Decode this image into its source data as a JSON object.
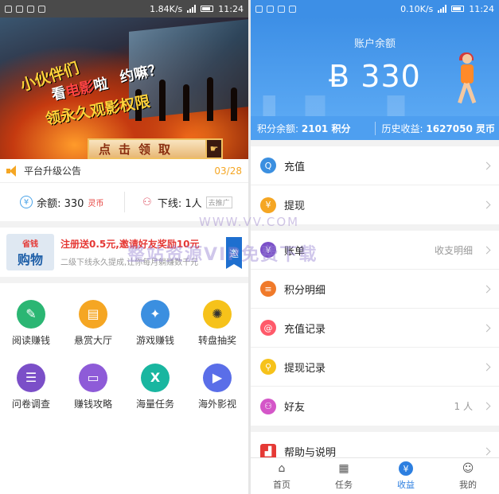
{
  "left": {
    "status": {
      "speed": "1.84K/s",
      "time": "11:24"
    },
    "banner": {
      "line1": "小伙伴们",
      "line2a": "看",
      "line2b": "电影",
      "line2c": "啦",
      "line3": "约嘛？",
      "line4": "领永久观影权限",
      "button": "点击领取"
    },
    "notice": {
      "text": "平台升级公告",
      "page": "03/28"
    },
    "balance": {
      "label": "余额: 330",
      "unit": "灵币"
    },
    "downline": {
      "label": "下线: 1人",
      "tag": "去推广"
    },
    "promo": {
      "logo_top": "省钱",
      "logo_bottom": "购物",
      "main": "注册送0.5元,邀请好友奖励10元",
      "sub": "二级下线永久提成,让你每月躺赚数千元",
      "flag": "邀"
    },
    "grid": [
      {
        "label": "阅读赚钱",
        "icon": "edit-icon",
        "color": "#2bb673",
        "glyph": "✎"
      },
      {
        "label": "悬赏大厅",
        "icon": "reward-icon",
        "color": "#f5a623",
        "glyph": "▤"
      },
      {
        "label": "游戏赚钱",
        "icon": "game-icon",
        "color": "#3b8fe0",
        "glyph": "✦"
      },
      {
        "label": "转盘抽奖",
        "icon": "wheel-icon",
        "color": "#f6c21a",
        "glyph": "✺"
      },
      {
        "label": "问卷调查",
        "icon": "survey-icon",
        "color": "#7b4fc8",
        "glyph": "☰"
      },
      {
        "label": "赚钱攻略",
        "icon": "guide-icon",
        "color": "#8e5bd8",
        "glyph": "▭"
      },
      {
        "label": "海量任务",
        "icon": "task-icon",
        "color": "#19b6a0",
        "glyph": "X"
      },
      {
        "label": "海外影视",
        "icon": "video-icon",
        "color": "#5a6ee8",
        "glyph": "▶"
      }
    ]
  },
  "right": {
    "status": {
      "speed": "0.10K/s",
      "time": "11:24"
    },
    "header": {
      "title": "账户余额",
      "amount": "Ƀ 330"
    },
    "stats": {
      "points_label": "积分余额:",
      "points_value": "2101 积分",
      "history_label": "历史收益:",
      "history_value": "1627050 灵币"
    },
    "group1": [
      {
        "label": "充值",
        "icon": "recharge-icon",
        "color": "#3b8fe0",
        "glyph": "Q"
      },
      {
        "label": "提现",
        "icon": "withdraw-icon",
        "color": "#f5a623",
        "glyph": "¥"
      }
    ],
    "group2": [
      {
        "label": "账单",
        "value": "收支明细",
        "icon": "bill-icon",
        "color": "#7b4fc8",
        "glyph": "¥"
      },
      {
        "label": "积分明细",
        "value": "",
        "icon": "points-icon",
        "color": "#f07a2a",
        "glyph": "≡"
      },
      {
        "label": "充值记录",
        "value": "",
        "icon": "recharge-record-icon",
        "color": "#ff5a6a",
        "glyph": "@"
      },
      {
        "label": "提现记录",
        "value": "",
        "icon": "withdraw-record-icon",
        "color": "#f6c21a",
        "glyph": "⚲"
      },
      {
        "label": "好友",
        "value": "1 人",
        "icon": "friends-icon",
        "color": "#d456c8",
        "glyph": "⚇"
      }
    ],
    "group3": [
      {
        "label": "帮助与说明",
        "icon": "help-icon",
        "color": "#e53935",
        "glyph": "▟"
      }
    ],
    "tabs": [
      {
        "label": "首页",
        "icon": "home-icon",
        "glyph": "⌂"
      },
      {
        "label": "任务",
        "icon": "tasks-icon",
        "glyph": "▦"
      },
      {
        "label": "收益",
        "icon": "earnings-icon",
        "glyph": "¥"
      },
      {
        "label": "我的",
        "icon": "profile-icon",
        "glyph": "☺"
      }
    ]
  },
  "watermark": {
    "top": "WWW.VV.COM",
    "main": "整站资源VIP免费下载"
  }
}
